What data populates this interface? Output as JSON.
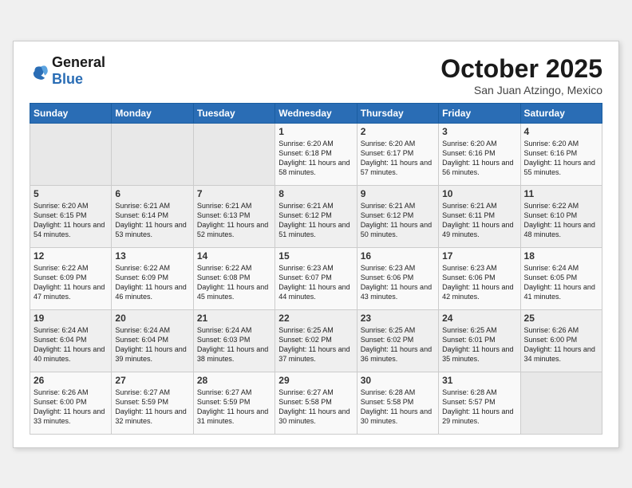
{
  "header": {
    "logo_line1": "General",
    "logo_line2": "Blue",
    "month": "October 2025",
    "location": "San Juan Atzingo, Mexico"
  },
  "weekdays": [
    "Sunday",
    "Monday",
    "Tuesday",
    "Wednesday",
    "Thursday",
    "Friday",
    "Saturday"
  ],
  "weeks": [
    [
      {
        "day": "",
        "sunrise": "",
        "sunset": "",
        "daylight": ""
      },
      {
        "day": "",
        "sunrise": "",
        "sunset": "",
        "daylight": ""
      },
      {
        "day": "",
        "sunrise": "",
        "sunset": "",
        "daylight": ""
      },
      {
        "day": "1",
        "sunrise": "Sunrise: 6:20 AM",
        "sunset": "Sunset: 6:18 PM",
        "daylight": "Daylight: 11 hours and 58 minutes."
      },
      {
        "day": "2",
        "sunrise": "Sunrise: 6:20 AM",
        "sunset": "Sunset: 6:17 PM",
        "daylight": "Daylight: 11 hours and 57 minutes."
      },
      {
        "day": "3",
        "sunrise": "Sunrise: 6:20 AM",
        "sunset": "Sunset: 6:16 PM",
        "daylight": "Daylight: 11 hours and 56 minutes."
      },
      {
        "day": "4",
        "sunrise": "Sunrise: 6:20 AM",
        "sunset": "Sunset: 6:16 PM",
        "daylight": "Daylight: 11 hours and 55 minutes."
      }
    ],
    [
      {
        "day": "5",
        "sunrise": "Sunrise: 6:20 AM",
        "sunset": "Sunset: 6:15 PM",
        "daylight": "Daylight: 11 hours and 54 minutes."
      },
      {
        "day": "6",
        "sunrise": "Sunrise: 6:21 AM",
        "sunset": "Sunset: 6:14 PM",
        "daylight": "Daylight: 11 hours and 53 minutes."
      },
      {
        "day": "7",
        "sunrise": "Sunrise: 6:21 AM",
        "sunset": "Sunset: 6:13 PM",
        "daylight": "Daylight: 11 hours and 52 minutes."
      },
      {
        "day": "8",
        "sunrise": "Sunrise: 6:21 AM",
        "sunset": "Sunset: 6:12 PM",
        "daylight": "Daylight: 11 hours and 51 minutes."
      },
      {
        "day": "9",
        "sunrise": "Sunrise: 6:21 AM",
        "sunset": "Sunset: 6:12 PM",
        "daylight": "Daylight: 11 hours and 50 minutes."
      },
      {
        "day": "10",
        "sunrise": "Sunrise: 6:21 AM",
        "sunset": "Sunset: 6:11 PM",
        "daylight": "Daylight: 11 hours and 49 minutes."
      },
      {
        "day": "11",
        "sunrise": "Sunrise: 6:22 AM",
        "sunset": "Sunset: 6:10 PM",
        "daylight": "Daylight: 11 hours and 48 minutes."
      }
    ],
    [
      {
        "day": "12",
        "sunrise": "Sunrise: 6:22 AM",
        "sunset": "Sunset: 6:09 PM",
        "daylight": "Daylight: 11 hours and 47 minutes."
      },
      {
        "day": "13",
        "sunrise": "Sunrise: 6:22 AM",
        "sunset": "Sunset: 6:09 PM",
        "daylight": "Daylight: 11 hours and 46 minutes."
      },
      {
        "day": "14",
        "sunrise": "Sunrise: 6:22 AM",
        "sunset": "Sunset: 6:08 PM",
        "daylight": "Daylight: 11 hours and 45 minutes."
      },
      {
        "day": "15",
        "sunrise": "Sunrise: 6:23 AM",
        "sunset": "Sunset: 6:07 PM",
        "daylight": "Daylight: 11 hours and 44 minutes."
      },
      {
        "day": "16",
        "sunrise": "Sunrise: 6:23 AM",
        "sunset": "Sunset: 6:06 PM",
        "daylight": "Daylight: 11 hours and 43 minutes."
      },
      {
        "day": "17",
        "sunrise": "Sunrise: 6:23 AM",
        "sunset": "Sunset: 6:06 PM",
        "daylight": "Daylight: 11 hours and 42 minutes."
      },
      {
        "day": "18",
        "sunrise": "Sunrise: 6:24 AM",
        "sunset": "Sunset: 6:05 PM",
        "daylight": "Daylight: 11 hours and 41 minutes."
      }
    ],
    [
      {
        "day": "19",
        "sunrise": "Sunrise: 6:24 AM",
        "sunset": "Sunset: 6:04 PM",
        "daylight": "Daylight: 11 hours and 40 minutes."
      },
      {
        "day": "20",
        "sunrise": "Sunrise: 6:24 AM",
        "sunset": "Sunset: 6:04 PM",
        "daylight": "Daylight: 11 hours and 39 minutes."
      },
      {
        "day": "21",
        "sunrise": "Sunrise: 6:24 AM",
        "sunset": "Sunset: 6:03 PM",
        "daylight": "Daylight: 11 hours and 38 minutes."
      },
      {
        "day": "22",
        "sunrise": "Sunrise: 6:25 AM",
        "sunset": "Sunset: 6:02 PM",
        "daylight": "Daylight: 11 hours and 37 minutes."
      },
      {
        "day": "23",
        "sunrise": "Sunrise: 6:25 AM",
        "sunset": "Sunset: 6:02 PM",
        "daylight": "Daylight: 11 hours and 36 minutes."
      },
      {
        "day": "24",
        "sunrise": "Sunrise: 6:25 AM",
        "sunset": "Sunset: 6:01 PM",
        "daylight": "Daylight: 11 hours and 35 minutes."
      },
      {
        "day": "25",
        "sunrise": "Sunrise: 6:26 AM",
        "sunset": "Sunset: 6:00 PM",
        "daylight": "Daylight: 11 hours and 34 minutes."
      }
    ],
    [
      {
        "day": "26",
        "sunrise": "Sunrise: 6:26 AM",
        "sunset": "Sunset: 6:00 PM",
        "daylight": "Daylight: 11 hours and 33 minutes."
      },
      {
        "day": "27",
        "sunrise": "Sunrise: 6:27 AM",
        "sunset": "Sunset: 5:59 PM",
        "daylight": "Daylight: 11 hours and 32 minutes."
      },
      {
        "day": "28",
        "sunrise": "Sunrise: 6:27 AM",
        "sunset": "Sunset: 5:59 PM",
        "daylight": "Daylight: 11 hours and 31 minutes."
      },
      {
        "day": "29",
        "sunrise": "Sunrise: 6:27 AM",
        "sunset": "Sunset: 5:58 PM",
        "daylight": "Daylight: 11 hours and 30 minutes."
      },
      {
        "day": "30",
        "sunrise": "Sunrise: 6:28 AM",
        "sunset": "Sunset: 5:58 PM",
        "daylight": "Daylight: 11 hours and 30 minutes."
      },
      {
        "day": "31",
        "sunrise": "Sunrise: 6:28 AM",
        "sunset": "Sunset: 5:57 PM",
        "daylight": "Daylight: 11 hours and 29 minutes."
      },
      {
        "day": "",
        "sunrise": "",
        "sunset": "",
        "daylight": ""
      }
    ]
  ]
}
